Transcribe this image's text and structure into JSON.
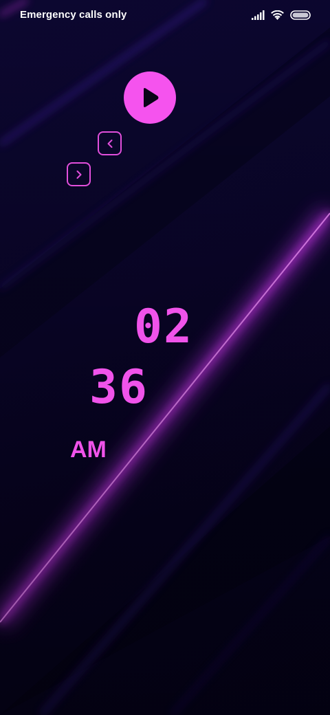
{
  "status_bar": {
    "carrier_text": "Emergency calls only",
    "icons": [
      "signal-icon",
      "wifi-icon",
      "battery-icon"
    ]
  },
  "controls": {
    "play_icon": "play-icon",
    "prev_icon": "chevron-left-icon",
    "next_icon": "chevron-right-icon"
  },
  "clock": {
    "hour": "02",
    "minute": "36",
    "period": "AM"
  },
  "colors": {
    "accent": "#f553ee",
    "background": "#0a052a",
    "streak": "#d23cf0"
  }
}
